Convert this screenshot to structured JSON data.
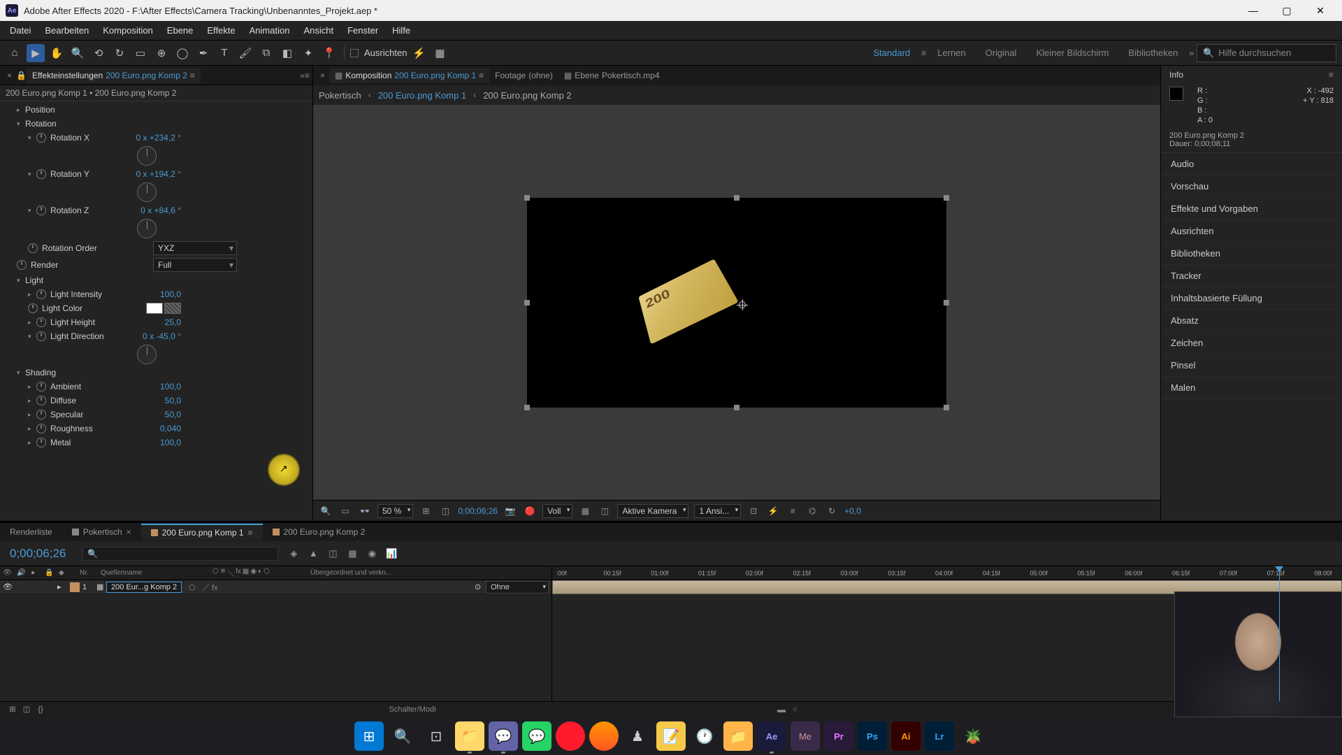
{
  "window": {
    "title": "Adobe After Effects 2020 - F:\\After Effects\\Camera Tracking\\Unbenanntes_Projekt.aep *"
  },
  "menu": {
    "items": [
      "Datei",
      "Bearbeiten",
      "Komposition",
      "Ebene",
      "Effekte",
      "Animation",
      "Ansicht",
      "Fenster",
      "Hilfe"
    ]
  },
  "toolbar": {
    "align_label": "Ausrichten",
    "workspaces": [
      "Standard",
      "Lernen",
      "Original",
      "Kleiner Bildschirm",
      "Bibliotheken"
    ],
    "search_placeholder": "Hilfe durchsuchen"
  },
  "effect_panel": {
    "tab_label": "Effekteinstellungen",
    "tab_comp": "200 Euro.png Komp 2",
    "header": "200 Euro.png Komp 1 • 200 Euro.png Komp 2",
    "position": "Position",
    "rotation": "Rotation",
    "rotation_x": "Rotation X",
    "rotation_x_val": "0 x +234,2 °",
    "rotation_y": "Rotation Y",
    "rotation_y_val": "0 x +194,2 °",
    "rotation_z": "Rotation Z",
    "rotation_z_val": "0 x +84,6 °",
    "rotation_order": "Rotation Order",
    "rotation_order_val": "YXZ",
    "render": "Render",
    "render_val": "Full",
    "light": "Light",
    "light_intensity": "Light Intensity",
    "light_intensity_val": "100,0",
    "light_color": "Light Color",
    "light_height": "Light Height",
    "light_height_val": "25,0",
    "light_direction": "Light Direction",
    "light_direction_val": "0 x -45,0 °",
    "shading": "Shading",
    "ambient": "Ambient",
    "ambient_val": "100,0",
    "diffuse": "Diffuse",
    "diffuse_val": "50,0",
    "specular": "Specular",
    "specular_val": "50,0",
    "roughness": "Roughness",
    "roughness_val": "0,040",
    "metal": "Metal",
    "metal_val": "100,0"
  },
  "viewer": {
    "tab_komposition": "Komposition",
    "tab_komposition_comp": "200 Euro.png Komp 1",
    "tab_footage": "Footage",
    "tab_footage_val": "(ohne)",
    "tab_ebene": "Ebene",
    "tab_ebene_val": "Pokertisch.mp4",
    "bc_pokertisch": "Pokertisch",
    "bc_komp1": "200 Euro.png Komp 1",
    "bc_komp2": "200 Euro.png Komp 2",
    "banknote_text": "200",
    "zoom": "50 %",
    "timecode": "0;00;06;26",
    "resolution": "Voll",
    "camera": "Aktive Kamera",
    "views": "1 Ansi...",
    "exposure": "+0,0"
  },
  "info": {
    "title": "Info",
    "r": "R :",
    "g": "G :",
    "b": "B :",
    "a": "A :",
    "a_val": "0",
    "x": "X :",
    "x_val": "-492",
    "y": "Y :",
    "y_val": "818",
    "comp_name": "200 Euro.png Komp 2",
    "duration": "Dauer: 0;00;08;11"
  },
  "right_panels": [
    "Audio",
    "Vorschau",
    "Effekte und Vorgaben",
    "Ausrichten",
    "Bibliotheken",
    "Tracker",
    "Inhaltsbasierte Füllung",
    "Absatz",
    "Zeichen",
    "Pinsel",
    "Malen"
  ],
  "timeline": {
    "tab_render": "Renderliste",
    "tab_pokertisch": "Pokertisch",
    "tab_komp1": "200 Euro.png Komp 1",
    "tab_komp2": "200 Euro.png Komp 2",
    "current_time": "0;00;06;26",
    "col_nr": "Nr.",
    "col_name": "Quellenname",
    "col_parent": "Übergeordnet und verkn...",
    "layer_num": "1",
    "layer_name": "200 Eur...g Komp 2",
    "parent_val": "Ohne",
    "ruler_ticks": [
      ":00f",
      "00:15f",
      "01:00f",
      "01:15f",
      "02:00f",
      "02:15f",
      "03:00f",
      "03:15f",
      "04:00f",
      "04:15f",
      "05:00f",
      "05:15f",
      "06:00f",
      "06:15f",
      "07:00f",
      "07:15f",
      "08:00f"
    ],
    "footer_label": "Schalter/Modi"
  }
}
